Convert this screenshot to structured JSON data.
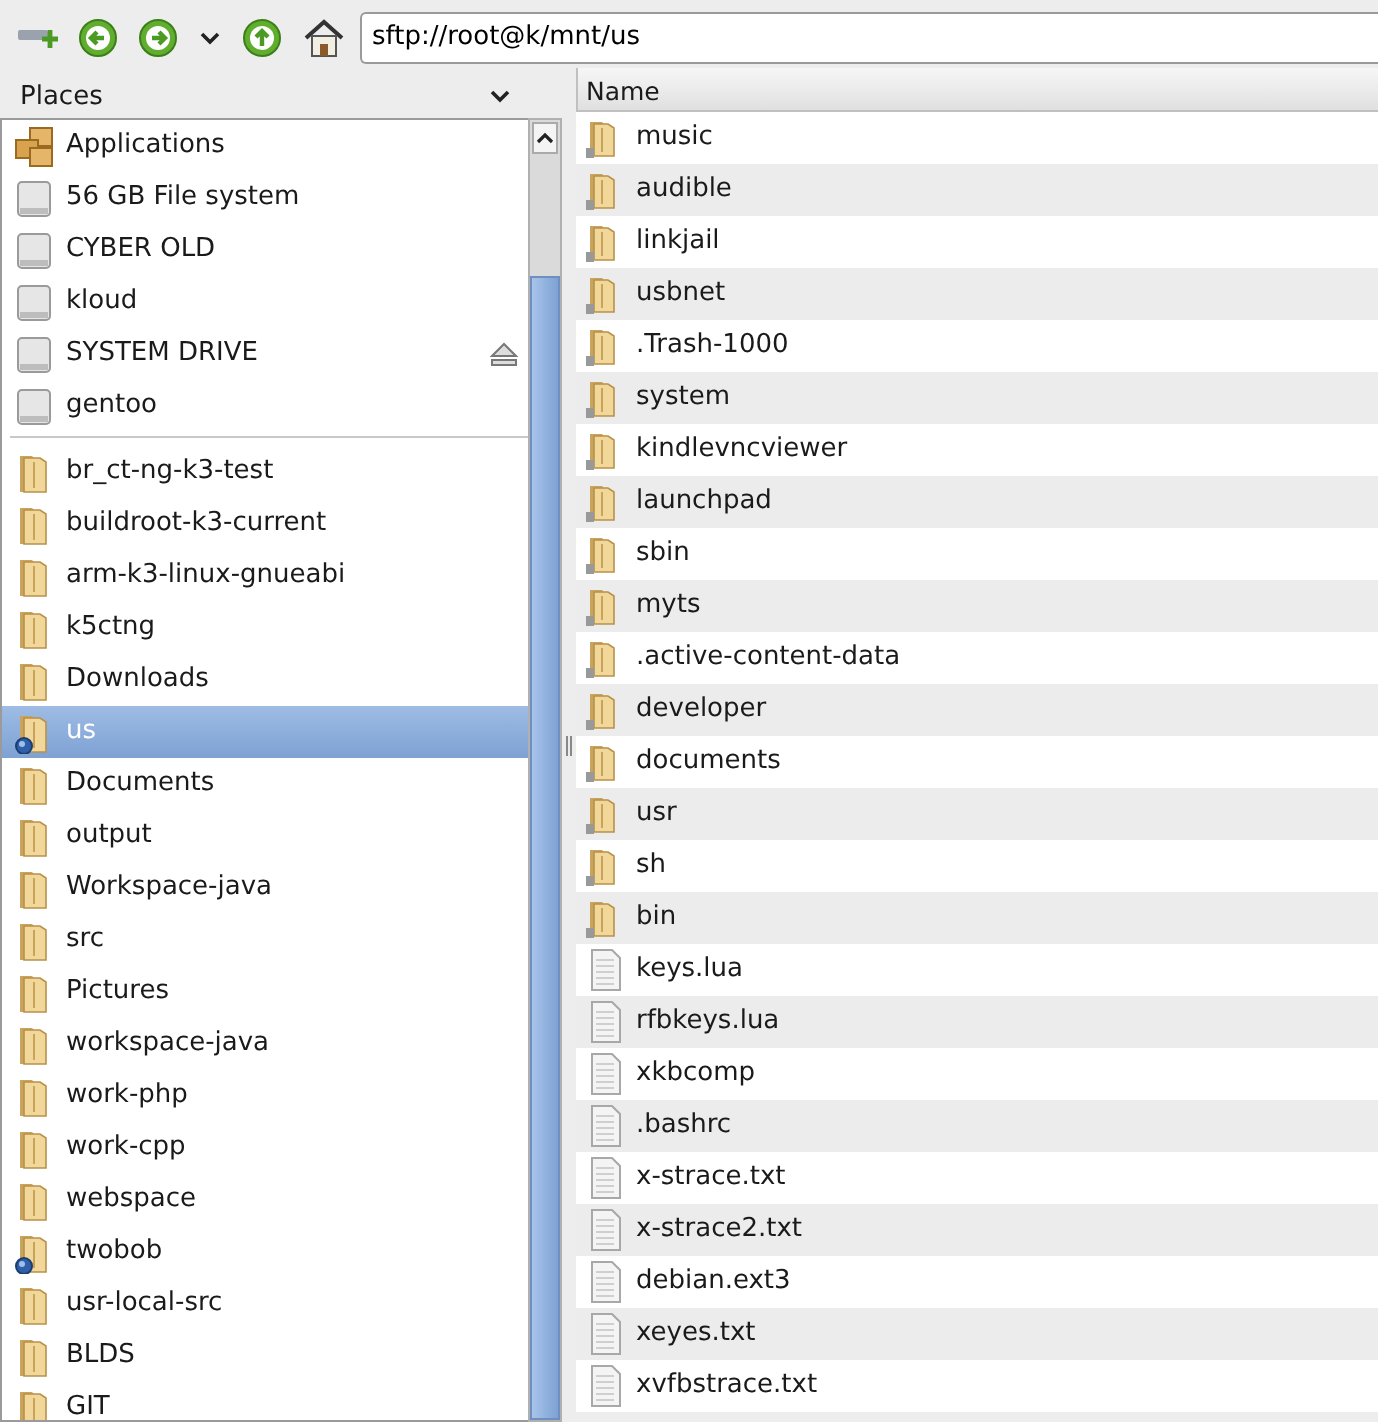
{
  "toolbar": {
    "address": "sftp://root@k/mnt/us"
  },
  "places": {
    "title": "Places",
    "devices": [
      {
        "label": "Applications",
        "kind": "apps",
        "ejectable": false
      },
      {
        "label": "56 GB File system",
        "kind": "drive",
        "ejectable": false
      },
      {
        "label": "CYBER OLD",
        "kind": "drive",
        "ejectable": false
      },
      {
        "label": "kloud",
        "kind": "drive",
        "ejectable": false
      },
      {
        "label": "SYSTEM DRIVE",
        "kind": "drive",
        "ejectable": true
      },
      {
        "label": "gentoo",
        "kind": "drive",
        "ejectable": false
      }
    ],
    "bookmarks": [
      {
        "label": "br_ct-ng-k3-test",
        "kind": "folder",
        "selected": false
      },
      {
        "label": "buildroot-k3-current",
        "kind": "folder",
        "selected": false
      },
      {
        "label": "arm-k3-linux-gnueabi",
        "kind": "folder",
        "selected": false
      },
      {
        "label": "k5ctng",
        "kind": "folder",
        "selected": false
      },
      {
        "label": "Downloads",
        "kind": "folder",
        "selected": false
      },
      {
        "label": "us",
        "kind": "remote",
        "selected": true
      },
      {
        "label": "Documents",
        "kind": "folder",
        "selected": false
      },
      {
        "label": "output",
        "kind": "folder",
        "selected": false
      },
      {
        "label": "Workspace-java",
        "kind": "folder",
        "selected": false
      },
      {
        "label": "src",
        "kind": "folder",
        "selected": false
      },
      {
        "label": "Pictures",
        "kind": "folder",
        "selected": false
      },
      {
        "label": "workspace-java",
        "kind": "folder",
        "selected": false
      },
      {
        "label": "work-php",
        "kind": "folder",
        "selected": false
      },
      {
        "label": "work-cpp",
        "kind": "folder",
        "selected": false
      },
      {
        "label": "webspace",
        "kind": "folder",
        "selected": false
      },
      {
        "label": "twobob",
        "kind": "remote",
        "selected": false
      },
      {
        "label": "usr-local-src",
        "kind": "folder",
        "selected": false
      },
      {
        "label": "BLDS",
        "kind": "folder",
        "selected": false
      },
      {
        "label": "GIT",
        "kind": "folder",
        "selected": false
      }
    ]
  },
  "files": {
    "columns": [
      "Name"
    ],
    "rows": [
      {
        "name": "music",
        "kind": "folder"
      },
      {
        "name": "audible",
        "kind": "folder"
      },
      {
        "name": "linkjail",
        "kind": "folder"
      },
      {
        "name": "usbnet",
        "kind": "folder"
      },
      {
        "name": ".Trash-1000",
        "kind": "folder"
      },
      {
        "name": "system",
        "kind": "folder"
      },
      {
        "name": "kindlevncviewer",
        "kind": "folder"
      },
      {
        "name": "launchpad",
        "kind": "folder"
      },
      {
        "name": "sbin",
        "kind": "folder"
      },
      {
        "name": "myts",
        "kind": "folder"
      },
      {
        "name": ".active-content-data",
        "kind": "folder"
      },
      {
        "name": "developer",
        "kind": "folder"
      },
      {
        "name": "documents",
        "kind": "folder"
      },
      {
        "name": "usr",
        "kind": "folder"
      },
      {
        "name": "sh",
        "kind": "folder"
      },
      {
        "name": "bin",
        "kind": "folder"
      },
      {
        "name": "keys.lua",
        "kind": "file"
      },
      {
        "name": "rfbkeys.lua",
        "kind": "file"
      },
      {
        "name": "xkbcomp",
        "kind": "file"
      },
      {
        "name": ".bashrc",
        "kind": "file"
      },
      {
        "name": "x-strace.txt",
        "kind": "file"
      },
      {
        "name": "x-strace2.txt",
        "kind": "file"
      },
      {
        "name": "debian.ext3",
        "kind": "file"
      },
      {
        "name": "xeyes.txt",
        "kind": "file"
      },
      {
        "name": "xvfbstrace.txt",
        "kind": "file"
      }
    ]
  }
}
